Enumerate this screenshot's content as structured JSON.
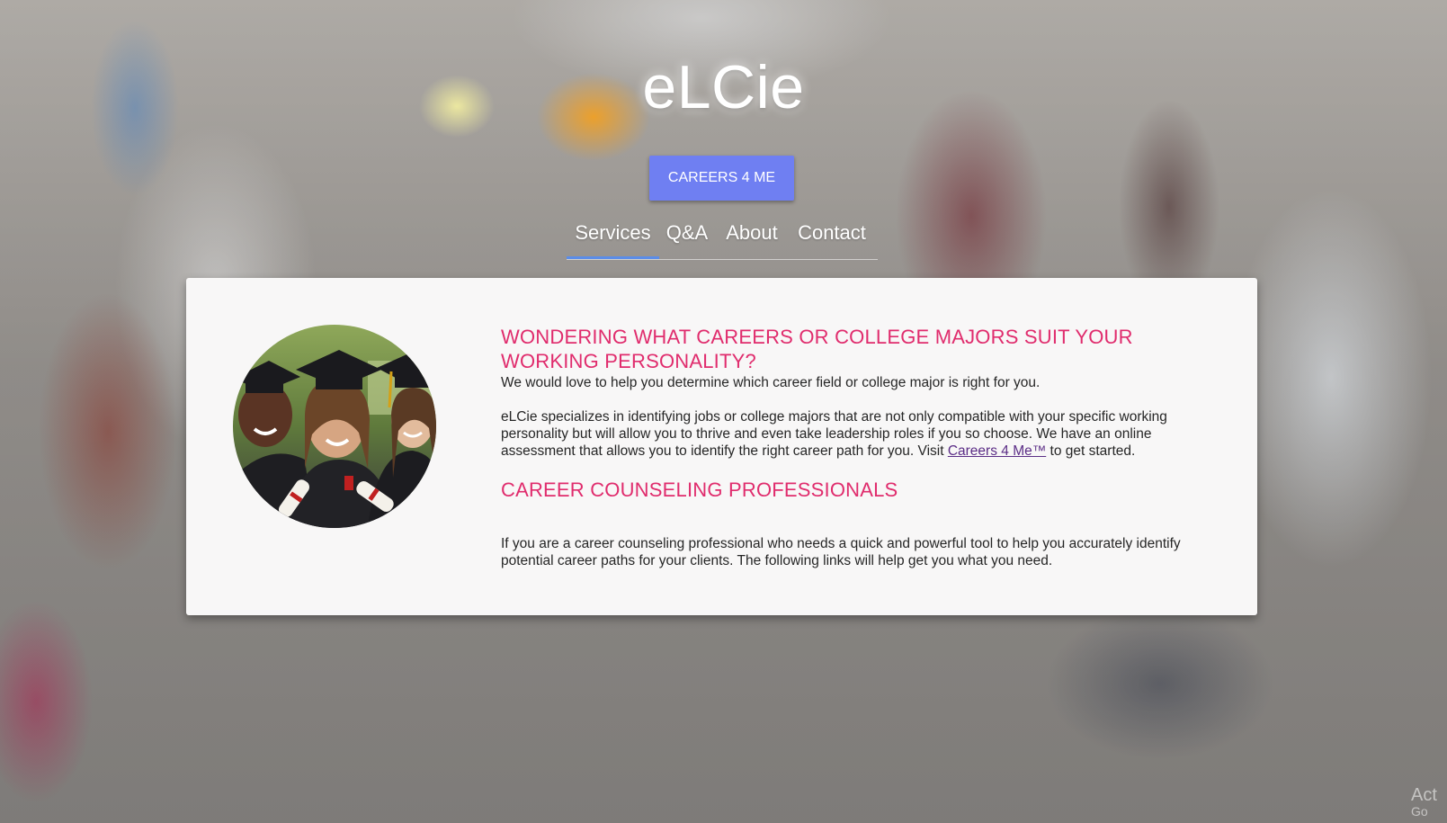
{
  "site": {
    "title": "eLCie",
    "cta_label": "CAREERS 4 ME"
  },
  "nav": {
    "items": [
      {
        "label": "Services",
        "active": true
      },
      {
        "label": "Q&A",
        "active": false
      },
      {
        "label": "About",
        "active": false
      },
      {
        "label": "Contact",
        "active": false
      }
    ]
  },
  "main": {
    "image_alt": "Three smiling graduates in caps and gowns holding diplomas",
    "section1": {
      "heading": "WONDERING WHAT CAREERS OR COLLEGE MAJORS SUIT YOUR WORKING PERSONALITY?",
      "paragraph1": "We would love to help you determine which career field or college major is right for you.",
      "paragraph2_before": "eLCie specializes in identifying jobs or college majors that are not only compatible with your specific working personality but will allow you to thrive and even take leadership roles if you so choose. We have an online assessment that allows you to identify the right career path for you. Visit ",
      "paragraph2_link": "Careers 4 Me™",
      "paragraph2_after": " to get started."
    },
    "section2": {
      "heading": "CAREER COUNSELING PROFESSIONALS",
      "paragraph": "If you are a career counseling professional who needs a quick and powerful tool to help you accurately identify potential career paths for your clients. The following links will help get you what you need."
    }
  },
  "watermark": {
    "line1": "Act",
    "line2": "Go"
  },
  "colors": {
    "accent_pink": "#e02c6d",
    "button_blue": "#6f7ff2",
    "nav_underline": "#5b8de8",
    "link_purple": "#5b2d86",
    "card_bg": "#f8f7f7"
  }
}
